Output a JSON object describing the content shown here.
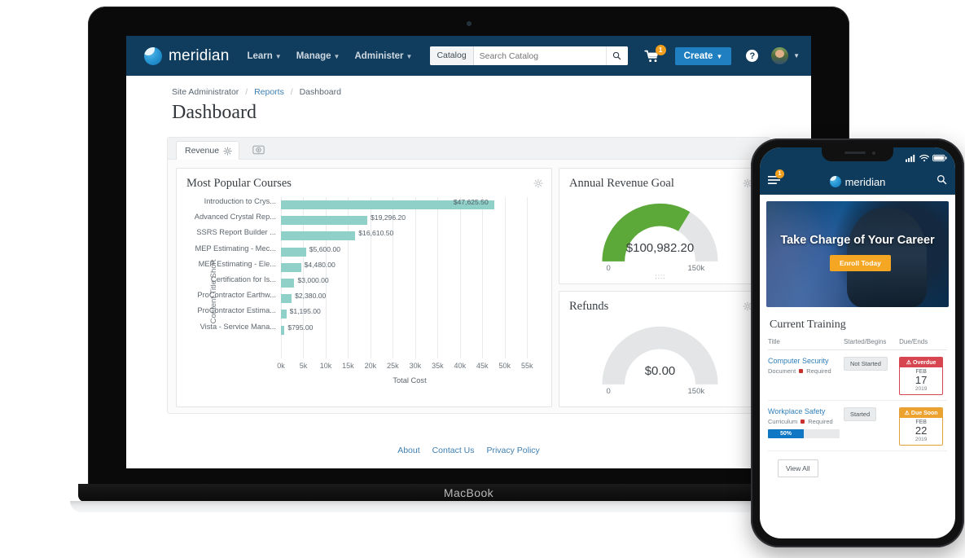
{
  "device": {
    "laptop_label": "MacBook"
  },
  "navbar": {
    "brand": "meridian",
    "links": [
      {
        "label": "Learn"
      },
      {
        "label": "Manage"
      },
      {
        "label": "Administer"
      }
    ],
    "search": {
      "category": "Catalog",
      "placeholder": "Search Catalog",
      "value": ""
    },
    "cart_count": "1",
    "create_label": "Create",
    "help_label": "?",
    "colors": {
      "navbar_bg": "#103C5D",
      "create_bg": "#1F7FC0",
      "badge": "#F0A01E"
    }
  },
  "breadcrumb": {
    "root": "Site Administrator",
    "mid": "Reports",
    "current": "Dashboard",
    "sep": "/"
  },
  "page": {
    "title": "Dashboard"
  },
  "panel": {
    "tab_label": "Revenue"
  },
  "cards": {
    "popular": {
      "title": "Most Popular Courses"
    },
    "revenue_goal": {
      "title": "Annual Revenue Goal"
    },
    "refunds": {
      "title": "Refunds"
    }
  },
  "chart_data": [
    {
      "type": "bar",
      "title": "Most Popular Courses",
      "orientation": "horizontal",
      "xlabel": "Total Cost",
      "ylabel": "Content Title Short",
      "xlim": [
        0,
        57500
      ],
      "xticks": [
        "0k",
        "5k",
        "10k",
        "15k",
        "20k",
        "25k",
        "30k",
        "35k",
        "40k",
        "45k",
        "50k",
        "55k"
      ],
      "xtick_values": [
        0,
        5000,
        10000,
        15000,
        20000,
        25000,
        30000,
        35000,
        40000,
        45000,
        50000,
        55000
      ],
      "grid": true,
      "bar_color": "#8FD0C8",
      "categories": [
        "Introduction to Crys...",
        "Advanced Crystal Rep...",
        "SSRS Report Builder ...",
        "MEP Estimating - Mec...",
        "MEP Estimating - Ele...",
        "Certification for Is...",
        "ProContractor Earthw...",
        "ProContractor Estima...",
        "Vista - Service Mana..."
      ],
      "values": [
        47625.5,
        19296.2,
        16610.5,
        5600.0,
        4480.0,
        3000.0,
        2380.0,
        1195.0,
        795.0
      ],
      "data_labels": [
        "$47,625.50",
        "$19,296.20",
        "$16,610.50",
        "$5,600.00",
        "$4,480.00",
        "$3,000.00",
        "$2,380.00",
        "$1,195.00",
        "$795.00"
      ]
    },
    {
      "type": "gauge",
      "title": "Annual Revenue Goal",
      "value": 100982.2,
      "value_label": "$100,982.20",
      "min": 0,
      "max": 150000,
      "min_label": "0",
      "max_label": "150k",
      "fill_color": "#5CA939",
      "track_color": "#E4E5E6",
      "percent": 67.3
    },
    {
      "type": "gauge",
      "title": "Refunds",
      "value": 0,
      "value_label": "$0.00",
      "min": 0,
      "max": 150000,
      "min_label": "0",
      "max_label": "150k",
      "fill_color": "#5CA939",
      "track_color": "#E4E5E6",
      "percent": 0
    }
  ],
  "footer": {
    "about": "About",
    "contact": "Contact Us",
    "privacy": "Privacy Policy"
  },
  "phone": {
    "brand": "meridian",
    "menu_badge": "1",
    "hero": {
      "headline": "Take Charge of Your Career",
      "button": "Enroll Today"
    },
    "section_title": "Current Training",
    "table_headers": {
      "title": "Title",
      "started": "Started/Begins",
      "due": "Due/Ends"
    },
    "rows": [
      {
        "title": "Computer Security",
        "type": "Document",
        "required": "Required",
        "status": "Not Started",
        "due_status": "Overdue",
        "due_month": "FEB",
        "due_day": "17",
        "due_year": "2019",
        "progress": null
      },
      {
        "title": "Workplace Safety",
        "type": "Curriculum",
        "required": "Required",
        "status": "Started",
        "due_status": "Due Soon",
        "due_month": "FEB",
        "due_day": "22",
        "due_year": "2019",
        "progress": "50%"
      }
    ],
    "view_all": "View All"
  }
}
